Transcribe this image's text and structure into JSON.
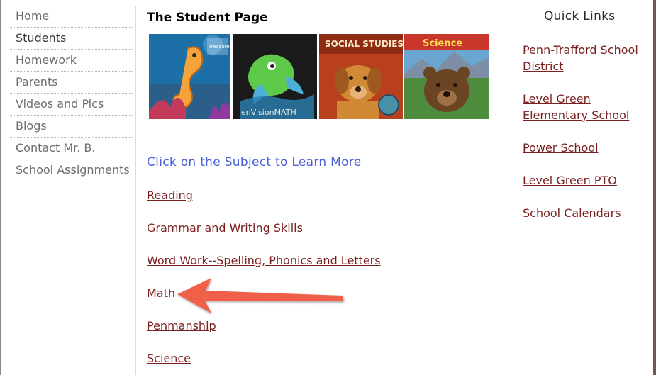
{
  "nav": {
    "items": [
      {
        "label": "Home"
      },
      {
        "label": "Students"
      },
      {
        "label": "Homework"
      },
      {
        "label": "Parents"
      },
      {
        "label": "Videos and Pics"
      },
      {
        "label": "Blogs"
      },
      {
        "label": "Contact Mr. B."
      },
      {
        "label": "School Assignments"
      }
    ],
    "active_index": 1
  },
  "main": {
    "title": "The Student Page",
    "book_covers": [
      {
        "name": "reading-treasures-cover",
        "text": "Treasures"
      },
      {
        "name": "envision-math-cover",
        "text": "enVisionMATH"
      },
      {
        "name": "social-studies-cover",
        "text": "SOCIAL STUDIES"
      },
      {
        "name": "science-cover",
        "text": "Science"
      }
    ],
    "subheading": "Click on the Subject to Learn More",
    "subjects": [
      {
        "label": "Reading"
      },
      {
        "label": "Grammar and Writing Skills"
      },
      {
        "label": "Word Work--Spelling, Phonics and Letters"
      },
      {
        "label": "Math"
      },
      {
        "label": "Penmanship"
      },
      {
        "label": "Science"
      }
    ]
  },
  "quick_links": {
    "heading": "Quick Links",
    "links": [
      {
        "label": "Penn-Trafford School District"
      },
      {
        "label": "Level Green Elementary School"
      },
      {
        "label": "Power School"
      },
      {
        "label": "Level Green PTO"
      },
      {
        "label": "School Calendars"
      }
    ]
  },
  "colors": {
    "link": "#7a2020",
    "subheading": "#4a5fd6",
    "annotation_arrow": "#f0614a"
  }
}
